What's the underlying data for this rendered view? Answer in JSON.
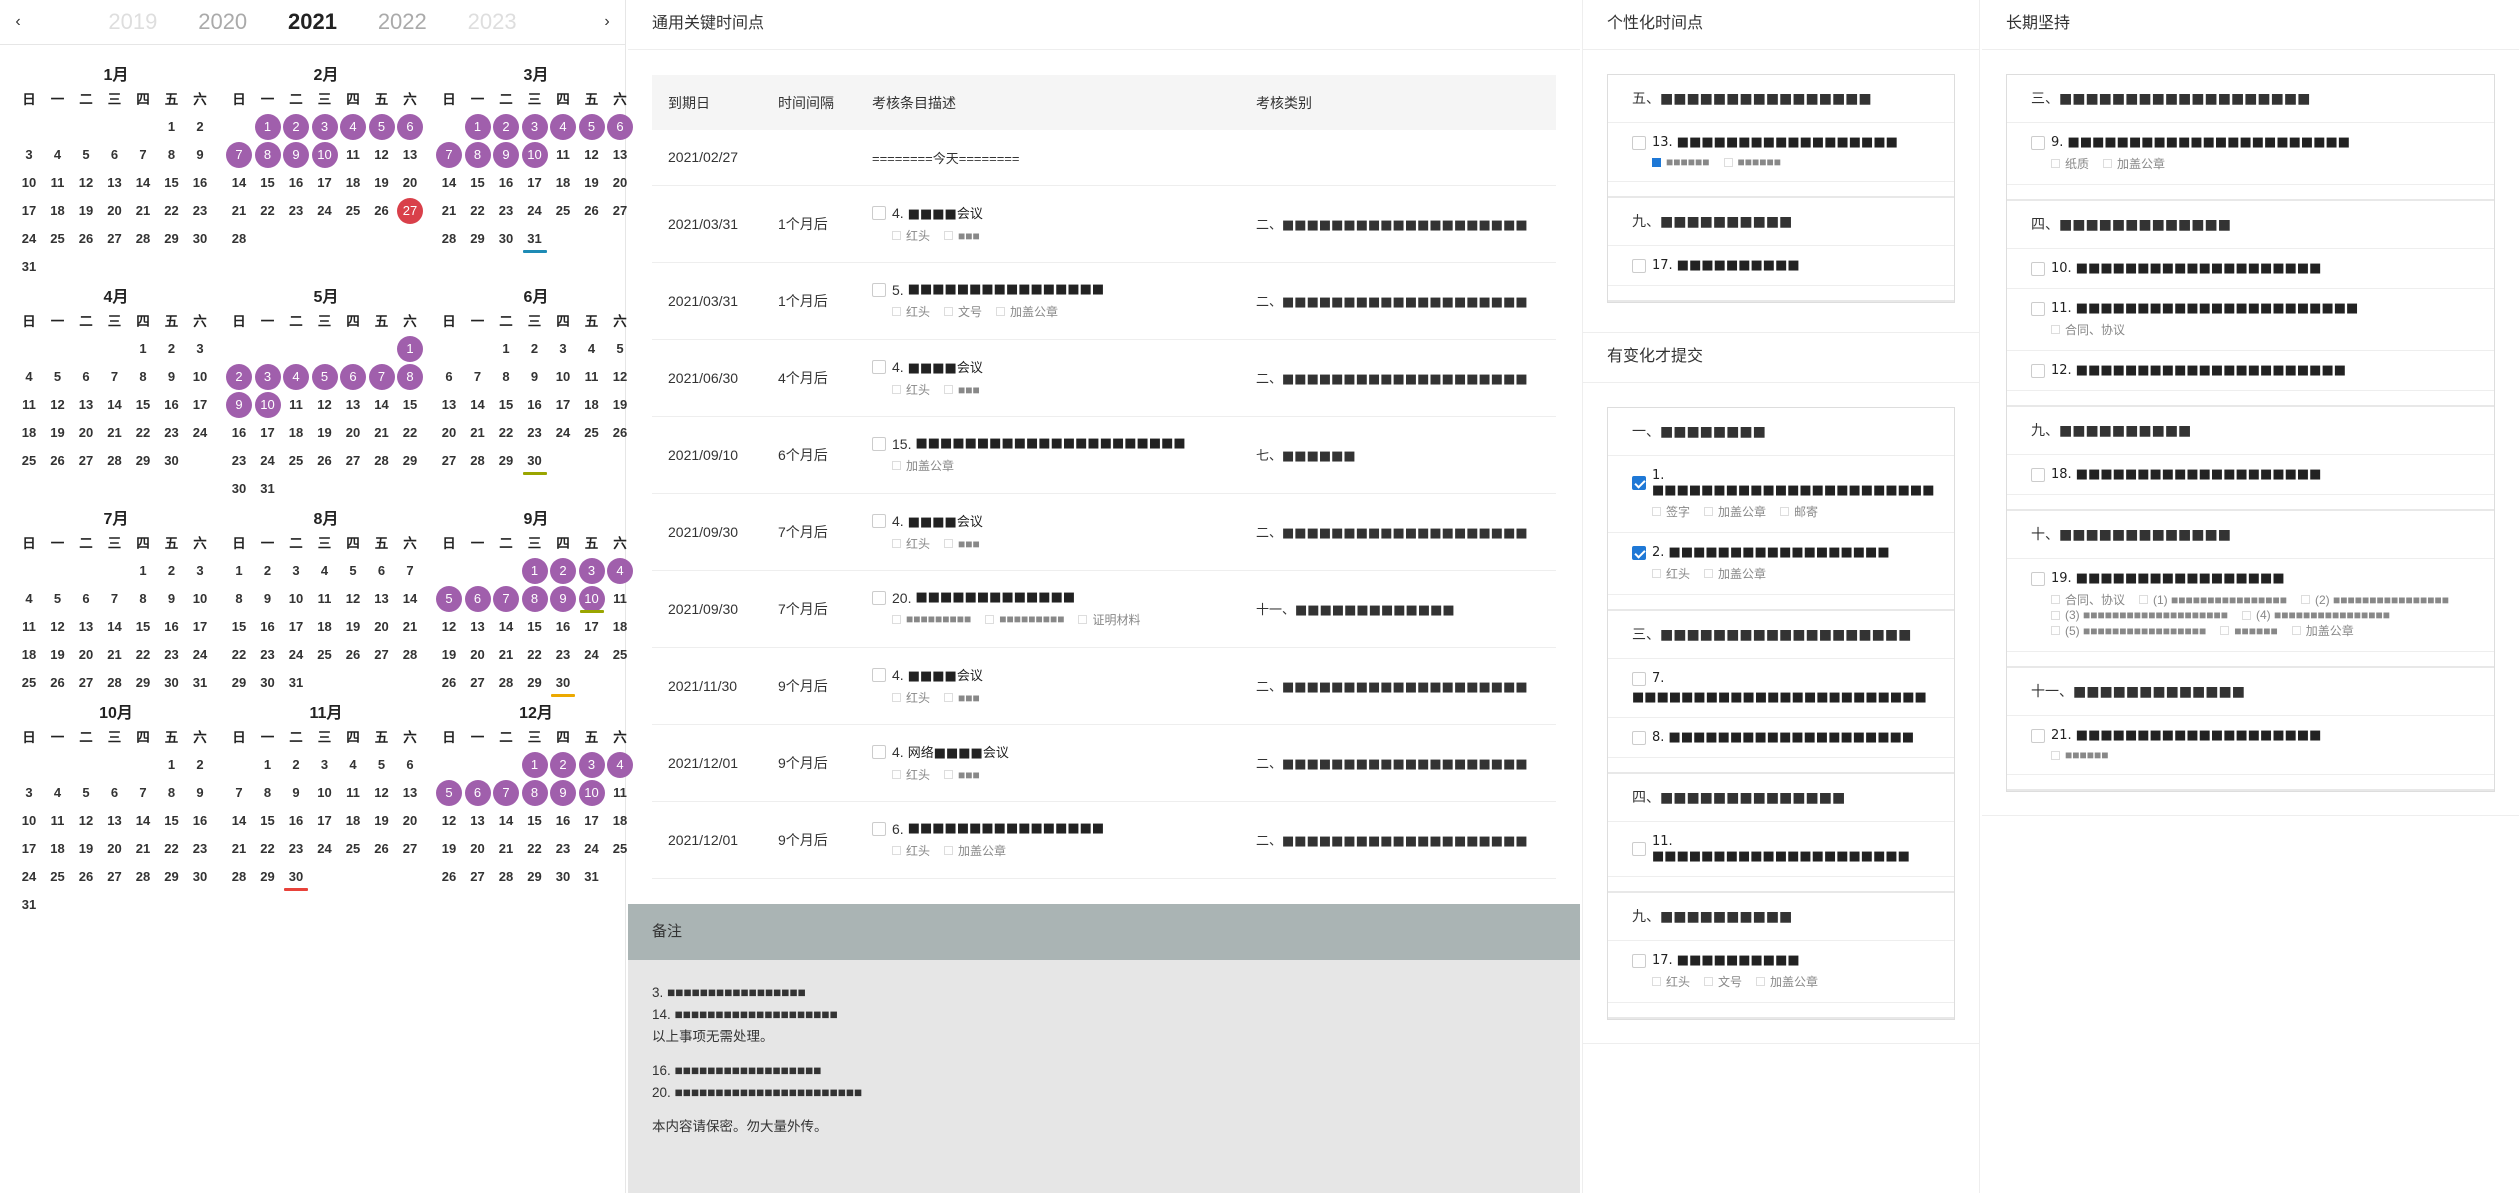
{
  "years": {
    "prev_arrow": "‹",
    "next_arrow": "›",
    "list": [
      "2019",
      "2020",
      "2021",
      "2022",
      "2023"
    ],
    "current": "2021"
  },
  "weekdays": [
    "日",
    "一",
    "二",
    "三",
    "四",
    "五",
    "六"
  ],
  "months": [
    {
      "name": "1月",
      "offset": 5,
      "days": 31
    },
    {
      "name": "2月",
      "offset": 1,
      "days": 28,
      "hl": [
        1,
        2,
        3,
        4,
        5,
        6,
        7,
        8,
        9,
        10
      ],
      "red": [
        27
      ]
    },
    {
      "name": "3月",
      "offset": 1,
      "days": 31,
      "hl": [
        1,
        2,
        3,
        4,
        5,
        6,
        7,
        8,
        9,
        10
      ],
      "ul_blue": [
        31
      ]
    },
    {
      "name": "4月",
      "offset": 4,
      "days": 30
    },
    {
      "name": "5月",
      "offset": 6,
      "days": 31,
      "hl": [
        1,
        2,
        3,
        4,
        5,
        6,
        7,
        8,
        9,
        10
      ]
    },
    {
      "name": "6月",
      "offset": 2,
      "days": 30,
      "ul_olive": [
        30
      ]
    },
    {
      "name": "7月",
      "offset": 4,
      "days": 31
    },
    {
      "name": "8月",
      "offset": 0,
      "days": 31
    },
    {
      "name": "9月",
      "offset": 3,
      "days": 30,
      "hl": [
        1,
        2,
        3,
        4,
        5,
        6,
        7,
        8,
        9,
        10
      ],
      "ul_olive": [
        10
      ],
      "ul_yellow": [
        30
      ]
    },
    {
      "name": "10月",
      "offset": 5,
      "days": 31
    },
    {
      "name": "11月",
      "offset": 1,
      "days": 30,
      "ul_red": [
        30
      ]
    },
    {
      "name": "12月",
      "offset": 3,
      "days": 31,
      "hl": [
        1,
        2,
        3,
        4,
        5,
        6,
        7,
        8,
        9,
        10
      ]
    }
  ],
  "key_points": {
    "title": "通用关键时间点",
    "headers": [
      "到期日",
      "时间间隔",
      "考核条目描述",
      "考核类别"
    ],
    "today_date": "2021/02/27",
    "today_label": "========今天========",
    "rows": [
      {
        "date": "2021/03/31",
        "interval": "1个月后",
        "num": "4.",
        "text": "■■■■会议",
        "tags": [
          "红头",
          "■■■"
        ],
        "cat": "二、■■■■■■■■■■■■■■■■■■■■"
      },
      {
        "date": "2021/03/31",
        "interval": "1个月后",
        "num": "5.",
        "text": "■■■■■■■■■■■■■■■■",
        "tags": [
          "红头",
          "文号",
          "加盖公章"
        ],
        "cat": "二、■■■■■■■■■■■■■■■■■■■■"
      },
      {
        "date": "2021/06/30",
        "interval": "4个月后",
        "num": "4.",
        "text": "■■■■会议",
        "tags": [
          "红头",
          "■■■"
        ],
        "cat": "二、■■■■■■■■■■■■■■■■■■■■"
      },
      {
        "date": "2021/09/10",
        "interval": "6个月后",
        "num": "15.",
        "text": "■■■■■■■■■■■■■■■■■■■■■■",
        "tags": [
          "加盖公章"
        ],
        "cat": "七、■■■■■■"
      },
      {
        "date": "2021/09/30",
        "interval": "7个月后",
        "num": "4.",
        "text": "■■■■会议",
        "tags": [
          "红头",
          "■■■"
        ],
        "cat": "二、■■■■■■■■■■■■■■■■■■■■"
      },
      {
        "date": "2021/09/30",
        "interval": "7个月后",
        "num": "20.",
        "text": "■■■■■■■■■■■■■",
        "tags": [
          "■■■■■■■■■",
          "■■■■■■■■■",
          "证明材料"
        ],
        "cat": "十一、■■■■■■■■■■■■■"
      },
      {
        "date": "2021/11/30",
        "interval": "9个月后",
        "num": "4.",
        "text": "■■■■会议",
        "tags": [
          "红头",
          "■■■"
        ],
        "cat": "二、■■■■■■■■■■■■■■■■■■■■"
      },
      {
        "date": "2021/12/01",
        "interval": "9个月后",
        "num": "4.",
        "text": "网络■■■■会议",
        "tags": [
          "红头",
          "■■■"
        ],
        "cat": "二、■■■■■■■■■■■■■■■■■■■■"
      },
      {
        "date": "2021/12/01",
        "interval": "9个月后",
        "num": "6.",
        "text": "■■■■■■■■■■■■■■■■",
        "tags": [
          "红头",
          "加盖公章"
        ],
        "cat": "二、■■■■■■■■■■■■■■■■■■■■"
      }
    ]
  },
  "notes": {
    "title": "备注",
    "lines_a": [
      "3. ■■■■■■■■■■■■■■■■■",
      "14. ■■■■■■■■■■■■■■■■■■■■",
      "以上事项无需处理。"
    ],
    "lines_b": [
      "16. ■■■■■■■■■■■■■■■■■■",
      "20. ■■■■■■■■■■■■■■■■■■■■■■■"
    ],
    "footer": "本内容请保密。勿大量外传。"
  },
  "personal": {
    "title": "个性化时间点",
    "sections": [
      {
        "title": "五、■■■■■■■■■■■■■■■■",
        "entries": [
          {
            "text": "13. ■■■■■■■■■■■■■■■■■■",
            "tags": [
              "■■■■■■",
              "■■■■■■"
            ],
            "tag_on": [
              0
            ]
          }
        ]
      },
      {
        "title": "九、■■■■■■■■■■",
        "entries": [
          {
            "text": "17. ■■■■■■■■■■",
            "tags": []
          }
        ]
      }
    ]
  },
  "changed": {
    "title": "有变化才提交",
    "sections": [
      {
        "title": "一、■■■■■■■■",
        "entries": [
          {
            "text": "1. ■■■■■■■■■■■■■■■■■■■■■■■",
            "checked": true,
            "tags": [
              "签字",
              "加盖公章",
              "邮寄"
            ]
          },
          {
            "text": "2. ■■■■■■■■■■■■■■■■■■",
            "checked": true,
            "tags": [
              "红头",
              "加盖公章"
            ]
          }
        ]
      },
      {
        "title": "三、■■■■■■■■■■■■■■■■■■■",
        "entries": [
          {
            "text": "7.",
            "text2": "■■■■■■■■■■■■■■■■■■■■■■■■",
            "tags": []
          },
          {
            "text": "8. ■■■■■■■■■■■■■■■■■■■■",
            "tags": []
          }
        ]
      },
      {
        "title": "四、■■■■■■■■■■■■■■",
        "entries": [
          {
            "text": "11. ■■■■■■■■■■■■■■■■■■■■■",
            "tags": []
          }
        ]
      },
      {
        "title": "九、■■■■■■■■■■",
        "entries": [
          {
            "text": "17. ■■■■■■■■■■",
            "tags": [
              "红头",
              "文号",
              "加盖公章"
            ]
          }
        ]
      }
    ]
  },
  "longterm": {
    "title": "长期坚持",
    "sections": [
      {
        "title": "三、■■■■■■■■■■■■■■■■■■■",
        "entries": [
          {
            "text": "9. ■■■■■■■■■■■■■■■■■■■■■■■",
            "tags": [
              "纸质",
              "加盖公章"
            ]
          }
        ]
      },
      {
        "title": "四、■■■■■■■■■■■■■",
        "entries": [
          {
            "text": "10. ■■■■■■■■■■■■■■■■■■■■",
            "tags": []
          },
          {
            "text": "11. ■■■■■■■■■■■■■■■■■■■■■■■",
            "tags": [
              "合同、协议"
            ]
          },
          {
            "text": "12. ■■■■■■■■■■■■■■■■■■■■■■",
            "tags": []
          }
        ]
      },
      {
        "title": "九、■■■■■■■■■■",
        "entries": [
          {
            "text": "18. ■■■■■■■■■■■■■■■■■■■■",
            "tags": []
          }
        ]
      },
      {
        "title": "十、■■■■■■■■■■■■■",
        "entries": [
          {
            "text": "19. ■■■■■■■■■■■■■■■■■",
            "tags": [
              "合同、协议",
              "(1) ■■■■■■■■■■■■■■■■",
              "(2) ■■■■■■■■■■■■■■■■",
              "(3) ■■■■■■■■■■■■■■■■■■■■",
              "(4) ■■■■■■■■■■■■■■■■",
              "(5) ■■■■■■■■■■■■■■■■■",
              "■■■■■■",
              "加盖公章"
            ]
          }
        ]
      },
      {
        "title": "十一、■■■■■■■■■■■■■",
        "entries": [
          {
            "text": "21. ■■■■■■■■■■■■■■■■■■■■",
            "tags": [
              "■■■■■■"
            ]
          }
        ]
      }
    ]
  }
}
